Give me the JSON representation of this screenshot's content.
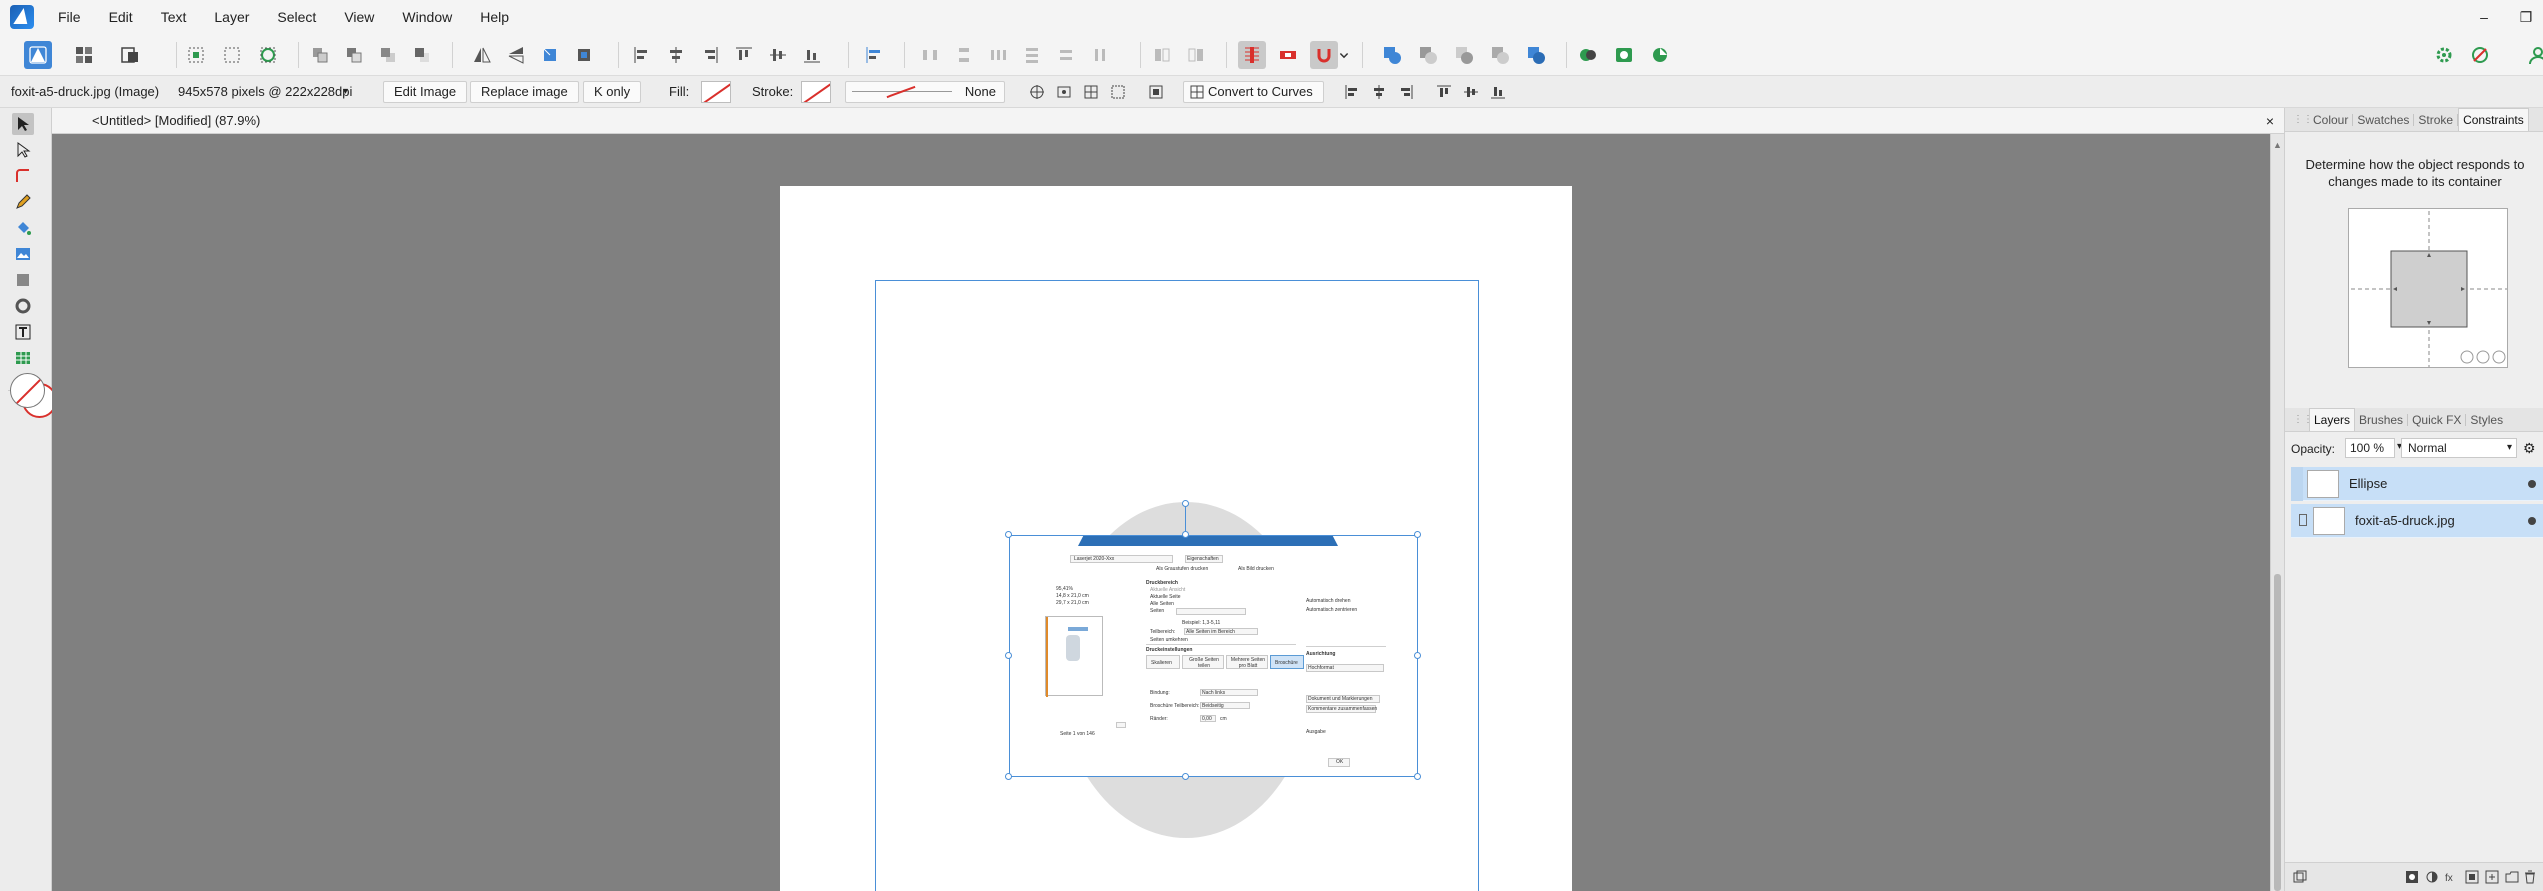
{
  "menu": [
    "File",
    "Edit",
    "Text",
    "Layer",
    "Select",
    "View",
    "Window",
    "Help"
  ],
  "window_controls": [
    "–",
    "❐"
  ],
  "context_bar": {
    "object_name": "foxit-a5-druck.jpg (Image)",
    "dimensions": "945x578 pixels @ 222x228dpi",
    "edit_image": "Edit Image",
    "replace_image": "Replace image",
    "k_only": "K only",
    "fill_label": "Fill:",
    "stroke_label": "Stroke:",
    "stroke_style": "None",
    "convert_to_curves": "Convert to Curves"
  },
  "document": {
    "tab_title": "<Untitled> [Modified] (87.9%)",
    "close": "×"
  },
  "embedded_screenshot": {
    "printer": "Laserjet 2020-Xxx",
    "properties": "Eigenschaften",
    "graustufen": "Als Graustufen drucken",
    "als_bild": "Als Bild drucken",
    "size_lines": [
      "95,41%",
      "14,8 x 21,0 cm",
      "29,7 x 21,0 cm"
    ],
    "druckbereich": "Druckbereich",
    "aktuelle_ansicht": "Aktuelle Ansicht",
    "aktuelle_seite": "Aktuelle Seite",
    "alle_seiten": "Alle Seiten",
    "seiten": "Seiten",
    "beispiel": "Beispiel: 1,3-5,11",
    "teilbereich": "Teilbereich:",
    "teilbereich_val": "Alle Seiten im Bereich",
    "seiten_umkehren": "Seiten umkehren",
    "druckeinstellungen": "Druckeinstellungen",
    "modes": [
      "Skalieren",
      "Große Seiten teilen",
      "Mehrere Seiten pro Blatt",
      "Broschüre"
    ],
    "bindung": "Bindung:",
    "bindung_val": "Nach links",
    "broschuere_teil": "Broschüre Teilbereich:",
    "broschuere_val": "Beidseitig",
    "raender": "Ränder:",
    "raender_val": "0,00",
    "raender_unit": "cm",
    "ausrichtung": "Ausrichtung",
    "ausrichtung_val": "Hochformat",
    "auto_drehen": "Automatisch drehen",
    "auto_zentrieren": "Automatisch zentrieren",
    "dokument": "Dokument und Markierungen",
    "kommentare": "Kommentare zusammenfassen",
    "ausgabe": "Ausgabe",
    "page_of": "Seite 1 von 146",
    "ok": "OK"
  },
  "panel_top": {
    "tabs": [
      "Colour",
      "Swatches",
      "Stroke",
      "Constraints"
    ],
    "selected_tab": "Constraints",
    "description": "Determine how the object responds to changes made to its container"
  },
  "panel_layers": {
    "tabs": [
      "Layers",
      "Brushes",
      "Quick FX",
      "Styles"
    ],
    "selected_tab": "Layers",
    "opacity_label": "Opacity:",
    "opacity_value": "100 %",
    "blend_mode": "Normal",
    "layers": [
      {
        "name": "Ellipse"
      },
      {
        "name": "foxit-a5-druck.jpg"
      }
    ]
  },
  "colors": {
    "accent": "#4a8fd7",
    "selection_row": "#c7dff7",
    "canvas_bg": "#808080",
    "stroke_none_red": "#d9302c",
    "brochure_blue": "#2c6fb6"
  },
  "icons": [
    "app-logo",
    "persona-icon",
    "align-icon",
    "gear-icon",
    "transform-icon",
    "move-tool-icon",
    "pen-icon",
    "brush-icon",
    "text-tool-icon",
    "ellipse-tool-icon",
    "eye-dot-icon",
    "lock-icon",
    "dropdown-chevron-icon"
  ]
}
